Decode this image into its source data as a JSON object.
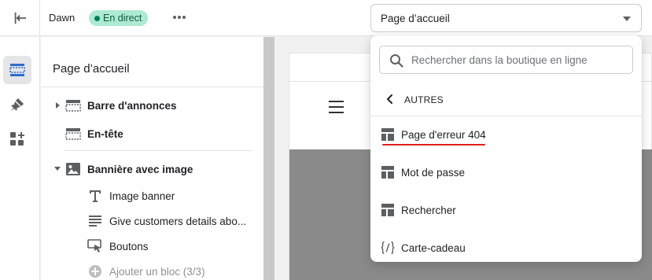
{
  "topbar": {
    "theme_name": "Dawn",
    "live_badge": "En direct",
    "page_select_value": "Page d’accueil"
  },
  "sidebar": {
    "title": "Page d’accueil",
    "items": [
      {
        "label": "Barre d'annonces"
      },
      {
        "label": "En-tête"
      },
      {
        "label": "Bannière avec image"
      },
      {
        "label": "Image banner"
      },
      {
        "label": "Give customers details abo..."
      },
      {
        "label": "Boutons"
      },
      {
        "label": "Ajouter un bloc (3/3)"
      }
    ]
  },
  "dropdown": {
    "search_placeholder": "Rechercher dans la boutique en ligne",
    "back_label": "AUTRES",
    "items": [
      {
        "label": "Page d'erreur 404",
        "icon": "template-icon"
      },
      {
        "label": "Mot de passe",
        "icon": "template-icon"
      },
      {
        "label": "Rechercher",
        "icon": "template-icon"
      },
      {
        "label": "Carte-cadeau",
        "icon": "code-braces-icon"
      }
    ]
  },
  "colors": {
    "live_badge_bg": "#aee9d1",
    "live_dot": "#007f5f",
    "highlight_underline": "#e01e1e",
    "hero_gray": "#8a8a8a"
  }
}
